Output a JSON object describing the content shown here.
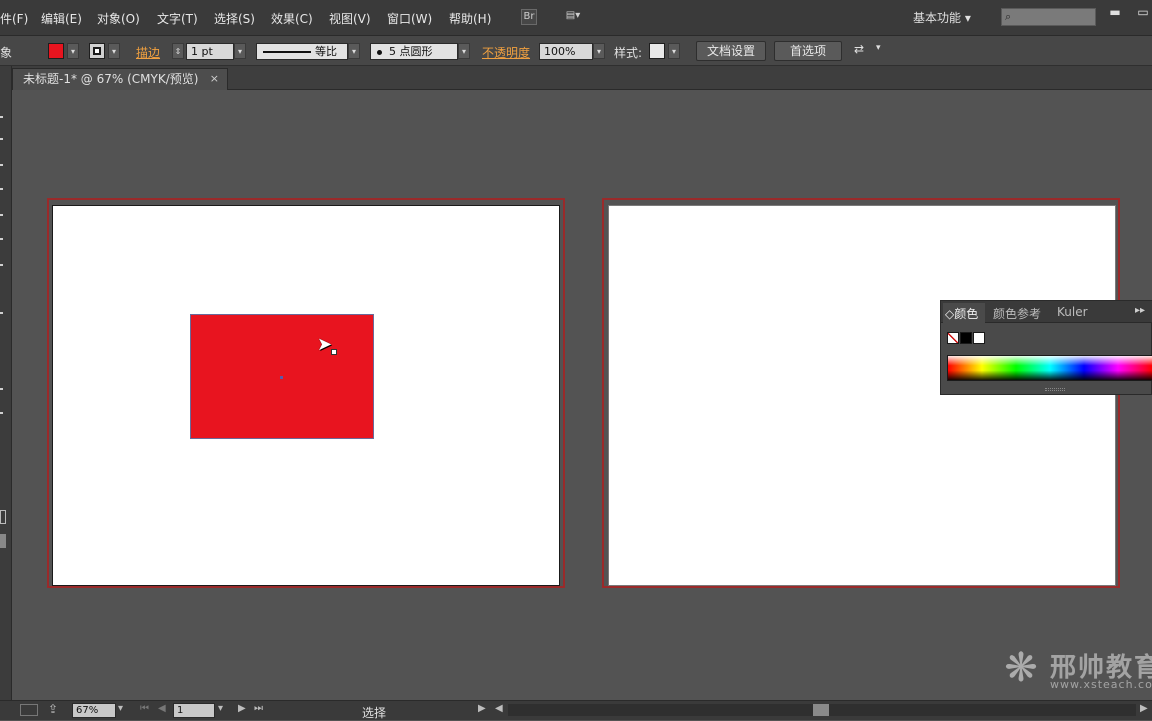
{
  "menubar": {
    "items": [
      "件(F)",
      "编辑(E)",
      "对象(O)",
      "文字(T)",
      "选择(S)",
      "效果(C)",
      "视图(V)",
      "窗口(W)",
      "帮助(H)"
    ],
    "bridge_icon": "Br",
    "arrange_icon": "▤▾",
    "workspace": "基本功能",
    "workspace_arrow": "▾",
    "search_placeholder": "",
    "search_glyph": "⌕",
    "minimize": "▬",
    "restore": "▭"
  },
  "controlbar": {
    "object_label": "象",
    "fill_color": "#e8141f",
    "stroke_color": "#1a1a1a",
    "stroke_label": "描边",
    "stroke_weight": "1 pt",
    "stroke_profile": "等比",
    "brush": "5 点圆形",
    "opacity_label": "不透明度",
    "opacity_value": "100%",
    "style_label": "样式:",
    "doc_setup_button": "文档设置",
    "preferences_button": "首选项",
    "arrange_glyph": "⇄",
    "arrow": "▾",
    "spinner": "⇕"
  },
  "document": {
    "tab_title": "未标题-1* @ 67% (CMYK/预览)",
    "close": "×"
  },
  "canvas": {
    "background": "#535353",
    "artboard_border_color": "#9a2a2a",
    "rect_fill": "#e8141f",
    "cursor_glyph": "➤"
  },
  "color_panel": {
    "tabs": [
      "颜色",
      "颜色参考",
      "Kuler"
    ],
    "active_tab_prefix": "◇",
    "menu_glyph": "▸▸",
    "none_swatch": "none",
    "black_swatch": "#000000",
    "white_swatch": "#ffffff"
  },
  "statusbar": {
    "zoom": "67%",
    "artboard_number": "1",
    "tool_status": "选择",
    "arrow": "▾",
    "first": "⏮",
    "prev": "◀",
    "next": "▶",
    "last": "⏭",
    "play": "▶",
    "scroll_left": "◀",
    "scroll_right": "▶"
  },
  "watermark": {
    "logo_glyph": "❋",
    "title": "邢帅教育",
    "url": "www.xsteach.com"
  }
}
